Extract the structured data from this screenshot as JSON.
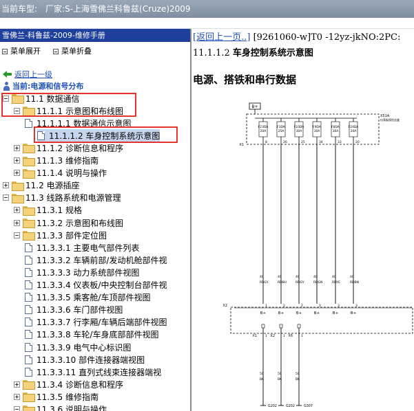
{
  "title_bar": {
    "label": "当前车型:",
    "vehicle": "厂家:S-上海雪佛兰科鲁兹(Cruze)2009"
  },
  "left_panel": {
    "manual_title": "雪佛兰-科鲁兹-2009-维修手册",
    "toolbar": {
      "expand_label": "菜单展开",
      "collapse_label": "菜单折叠"
    },
    "back_link": "返回上一级",
    "current_location": "当前:电源和信号分布",
    "tree": [
      {
        "label": "11.1 数据通信",
        "expander": "minus",
        "icon": "folder-icon"
      },
      {
        "label": "11.1.1 示意图和布线图",
        "expander": "minus",
        "icon": "folder-icon"
      },
      {
        "label": "11.1.1.1 数据通信示意图",
        "expander": "",
        "icon": "document-icon"
      },
      {
        "label": "11.1.1.2 车身控制系统示意图",
        "expander": "",
        "icon": "document-icon",
        "selected": true
      },
      {
        "label": "11.1.2 诊断信息和程序",
        "expander": "plus",
        "icon": "folder-icon"
      },
      {
        "label": "11.1.3 维修指南",
        "expander": "plus",
        "icon": "folder-icon"
      },
      {
        "label": "11.1.4 说明与操作",
        "expander": "plus",
        "icon": "folder-icon"
      },
      {
        "label": "11.2 电源插座",
        "expander": "plus",
        "icon": "folder-icon"
      },
      {
        "label": "11.3 线路系统和电源管理",
        "expander": "minus",
        "icon": "folder-icon"
      },
      {
        "label": "11.3.1 规格",
        "expander": "plus",
        "icon": "folder-icon"
      },
      {
        "label": "11.3.2 示意图和布线图",
        "expander": "plus",
        "icon": "folder-icon"
      },
      {
        "label": "11.3.3 部件定位图",
        "expander": "minus",
        "icon": "folder-icon"
      },
      {
        "label": "11.3.3.1 主要电气部件列表",
        "expander": "",
        "icon": "document-icon"
      },
      {
        "label": "11.3.3.2 车辆前部/发动机舱部件视",
        "expander": "",
        "icon": "document-icon"
      },
      {
        "label": "11.3.3.3 动力系统部件视图",
        "expander": "",
        "icon": "document-icon"
      },
      {
        "label": "11.3.3.4 仪表板/中央控制台部件视",
        "expander": "",
        "icon": "document-icon"
      },
      {
        "label": "11.3.3.5 乘客舱/车顶部件视图",
        "expander": "",
        "icon": "document-icon"
      },
      {
        "label": "11.3.3.6 车门部件视图",
        "expander": "",
        "icon": "document-icon"
      },
      {
        "label": "11.3.3.7 行李厢/车辆后端部件视图",
        "expander": "",
        "icon": "document-icon"
      },
      {
        "label": "11.3.3.8 车轮/车身底部部件视图",
        "expander": "",
        "icon": "document-icon"
      },
      {
        "label": "11.3.3.9 电气中心标识图",
        "expander": "",
        "icon": "document-icon"
      },
      {
        "label": "11.3.3.10 部件连接器端视图",
        "expander": "",
        "icon": "document-icon"
      },
      {
        "label": "11.3.3.11 直列式线束连接器端视",
        "expander": "",
        "icon": "document-icon"
      },
      {
        "label": "11.3.4 诊断信息和程序",
        "expander": "plus",
        "icon": "folder-icon"
      },
      {
        "label": "11.3.5 维修指南",
        "expander": "plus",
        "icon": "folder-icon"
      },
      {
        "label": "11.3.6 说明与操作",
        "expander": "minus",
        "icon": "folder-icon"
      }
    ]
  },
  "right_panel": {
    "back_link": "[返回上一页..]",
    "doc_code": "[9261060-w]T0 -12yz-jkNO:2PC:",
    "section_number": "11.1.1.2",
    "section_title": "车身控制系统示意图",
    "heading": "电源、搭铁和串行数据",
    "diagram": {
      "top_terminal": "B+",
      "fuse_box_label": "X51A",
      "fuse_box_sublabel": "仪表板保险丝盒",
      "top_connector": "X1",
      "fuses": [
        {
          "name": "F23DA",
          "rating": "20A",
          "pin": "8"
        },
        {
          "name": "F3DA",
          "rating": "25A",
          "pin": "26"
        },
        {
          "name": "F10DA",
          "rating": "30A",
          "pin": "25"
        },
        {
          "name": "F9DA",
          "rating": "30A",
          "pin": "34"
        },
        {
          "name": "F8DA",
          "rating": "30A",
          "pin": "33"
        },
        {
          "name": "F24DA",
          "rating": "20A",
          "pin": "20"
        }
      ],
      "wires": [
        {
          "gauge": "40",
          "color": "RDGY"
        },
        {
          "gauge": "40",
          "color": "RDBU"
        },
        {
          "gauge": "40",
          "color": "RDGY"
        },
        {
          "gauge": "40",
          "color": "RDGN"
        },
        {
          "gauge": "40",
          "color": "RDYE"
        },
        {
          "gauge": "40",
          "color": "RDBN"
        }
      ],
      "module_connector_left": "X2",
      "module_pins": [
        "1",
        "2",
        "2",
        "2",
        "3",
        "3"
      ],
      "module_input": "B+",
      "ground_pins": [
        {
          "connector": "X1",
          "pin": "1"
        },
        {
          "connector": "X2",
          "pin": "1"
        },
        {
          "connector": "X6",
          "pin": "1"
        }
      ],
      "ground_wires": [
        {
          "gauge": "50",
          "color": "BK"
        },
        {
          "gauge": "50",
          "color": "BK"
        },
        {
          "gauge": "50",
          "color": "BK"
        }
      ],
      "ground_points": [
        "G202",
        "G202",
        "G307"
      ]
    }
  }
}
